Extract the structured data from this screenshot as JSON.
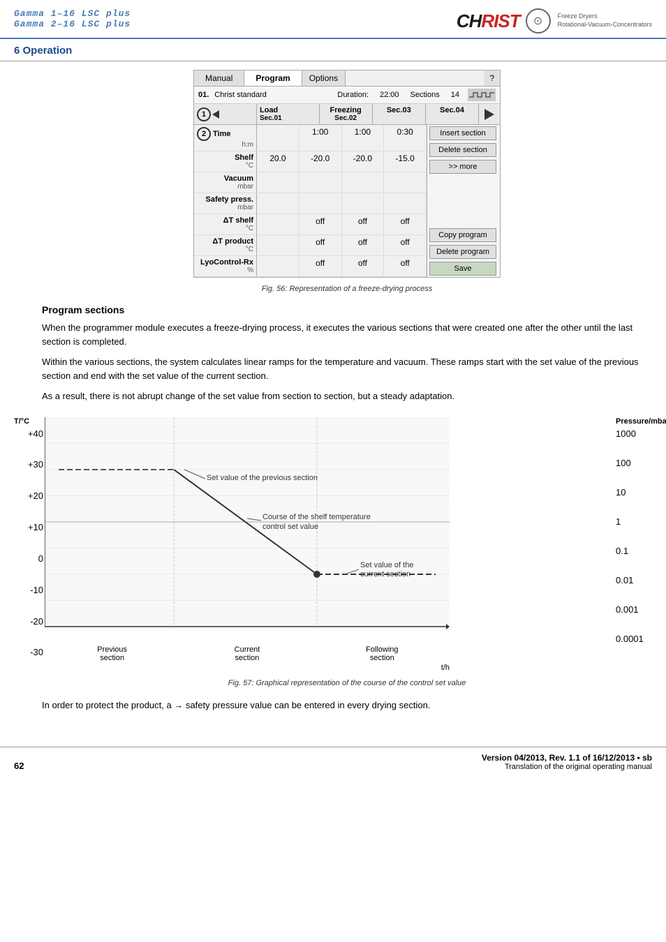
{
  "header": {
    "title_line1": "Gamma 1–16 LSC plus",
    "title_line2": "Gamma 2–16 LSC plus",
    "logo_ch": "CH",
    "logo_rist": "RIST",
    "logo_sub1": "Freeze Dryers",
    "logo_sub2": "Rotational-Vacuum-Concentrators",
    "section_heading": "6 Operation"
  },
  "panel": {
    "tab_manual": "Manual",
    "tab_program": "Program",
    "tab_options": "Options",
    "tab_question": "?",
    "program_num": "01.",
    "program_name": "Christ standard",
    "duration_label": "Duration:",
    "duration_value": "22:00",
    "sections_label": "Sections",
    "sections_value": "14",
    "col_load": "Load",
    "col_sec01": "Sec.01",
    "col_freezing": "Freezing",
    "col_sec02": "Sec.02",
    "col_sec03": "Sec.03",
    "col_sec04": "Sec.04",
    "rows": [
      {
        "label_top": "Time",
        "label_bottom": "h:m",
        "cells": [
          "",
          "1:00",
          "1:00",
          "0:30"
        ],
        "option": "Insert section"
      },
      {
        "label_top": "Shelf",
        "label_bottom": "°C",
        "cells": [
          "20.0",
          "-20.0",
          "-20.0",
          "-15.0"
        ],
        "option": "Delete section"
      },
      {
        "label_top": "Vacuum",
        "label_bottom": "mbar",
        "cells": [
          "",
          "",
          "",
          ""
        ],
        "option": ">> more"
      },
      {
        "label_top": "Safety press.",
        "label_bottom": "mbar",
        "cells": [
          "",
          "",
          "",
          ""
        ],
        "option": ""
      },
      {
        "label_top": "ΔT shelf",
        "label_bottom": "°C",
        "cells": [
          "",
          "off",
          "off",
          "off"
        ],
        "option": "Copy program"
      },
      {
        "label_top": "ΔT product",
        "label_bottom": "°C",
        "cells": [
          "",
          "off",
          "off",
          "off"
        ],
        "option": "Delete program"
      },
      {
        "label_top": "LyoControl-Rx",
        "label_bottom": "%",
        "cells": [
          "",
          "off",
          "off",
          "off"
        ],
        "option": "Save"
      }
    ]
  },
  "fig56_caption": "Fig. 56: Representation of a freeze-drying process",
  "section_title": "Program sections",
  "paragraph1": "When the programmer module executes a freeze-drying process, it executes the various sections that were created one after the other until the last section is completed.",
  "paragraph2": "Within the various sections, the system calculates linear ramps for the temperature and vacuum. These ramps start with the set value of the previous section and end with the set value of the current section.",
  "paragraph3": "As a result, there is not abrupt change of the set value from section to section, but a steady adaptation.",
  "chart": {
    "y_left_label": "T/°C",
    "y_left_values": [
      "+40",
      "+30",
      "+20",
      "+10",
      "0",
      "-10",
      "-20",
      "-30"
    ],
    "y_right_label": "Pressure/mbar",
    "y_right_values": [
      "1000",
      "100",
      "10",
      "1",
      "0.1",
      "0.01",
      "0.001",
      "0.0001"
    ],
    "x_labels": [
      "Previous\nsection",
      "Current\nsection",
      "Following\nsection"
    ],
    "x_axis_label": "t/h",
    "annotation1": "Set value of the previous section",
    "annotation2": "Course of the shelf temperature\ncontrol set value",
    "annotation3": "Set value of the\ncurrent section"
  },
  "fig57_caption": "Fig. 57: Graphical representation of the course of the control set value",
  "paragraph4": "In order to protect the product, a → safety pressure value can be entered in every drying section.",
  "footer": {
    "page_num": "62",
    "version": "Version 04/2013, Rev. 1.1 of 16/12/2013 • sb",
    "translation": "Translation of the original operating manual"
  }
}
